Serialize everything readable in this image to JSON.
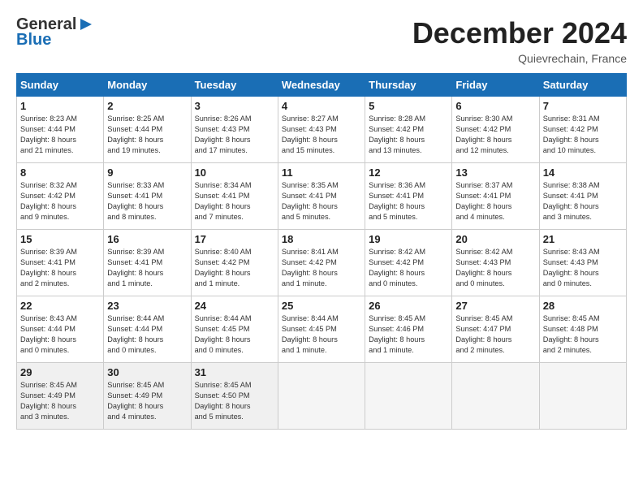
{
  "header": {
    "logo_line1": "General",
    "logo_line2": "Blue",
    "month_title": "December 2024",
    "location": "Quievrechain, France"
  },
  "days_of_week": [
    "Sunday",
    "Monday",
    "Tuesday",
    "Wednesday",
    "Thursday",
    "Friday",
    "Saturday"
  ],
  "weeks": [
    [
      {
        "day": "1",
        "text": "Sunrise: 8:23 AM\nSunset: 4:44 PM\nDaylight: 8 hours\nand 21 minutes."
      },
      {
        "day": "2",
        "text": "Sunrise: 8:25 AM\nSunset: 4:44 PM\nDaylight: 8 hours\nand 19 minutes."
      },
      {
        "day": "3",
        "text": "Sunrise: 8:26 AM\nSunset: 4:43 PM\nDaylight: 8 hours\nand 17 minutes."
      },
      {
        "day": "4",
        "text": "Sunrise: 8:27 AM\nSunset: 4:43 PM\nDaylight: 8 hours\nand 15 minutes."
      },
      {
        "day": "5",
        "text": "Sunrise: 8:28 AM\nSunset: 4:42 PM\nDaylight: 8 hours\nand 13 minutes."
      },
      {
        "day": "6",
        "text": "Sunrise: 8:30 AM\nSunset: 4:42 PM\nDaylight: 8 hours\nand 12 minutes."
      },
      {
        "day": "7",
        "text": "Sunrise: 8:31 AM\nSunset: 4:42 PM\nDaylight: 8 hours\nand 10 minutes."
      }
    ],
    [
      {
        "day": "8",
        "text": "Sunrise: 8:32 AM\nSunset: 4:42 PM\nDaylight: 8 hours\nand 9 minutes."
      },
      {
        "day": "9",
        "text": "Sunrise: 8:33 AM\nSunset: 4:41 PM\nDaylight: 8 hours\nand 8 minutes."
      },
      {
        "day": "10",
        "text": "Sunrise: 8:34 AM\nSunset: 4:41 PM\nDaylight: 8 hours\nand 7 minutes."
      },
      {
        "day": "11",
        "text": "Sunrise: 8:35 AM\nSunset: 4:41 PM\nDaylight: 8 hours\nand 5 minutes."
      },
      {
        "day": "12",
        "text": "Sunrise: 8:36 AM\nSunset: 4:41 PM\nDaylight: 8 hours\nand 5 minutes."
      },
      {
        "day": "13",
        "text": "Sunrise: 8:37 AM\nSunset: 4:41 PM\nDaylight: 8 hours\nand 4 minutes."
      },
      {
        "day": "14",
        "text": "Sunrise: 8:38 AM\nSunset: 4:41 PM\nDaylight: 8 hours\nand 3 minutes."
      }
    ],
    [
      {
        "day": "15",
        "text": "Sunrise: 8:39 AM\nSunset: 4:41 PM\nDaylight: 8 hours\nand 2 minutes."
      },
      {
        "day": "16",
        "text": "Sunrise: 8:39 AM\nSunset: 4:41 PM\nDaylight: 8 hours\nand 1 minute."
      },
      {
        "day": "17",
        "text": "Sunrise: 8:40 AM\nSunset: 4:42 PM\nDaylight: 8 hours\nand 1 minute."
      },
      {
        "day": "18",
        "text": "Sunrise: 8:41 AM\nSunset: 4:42 PM\nDaylight: 8 hours\nand 1 minute."
      },
      {
        "day": "19",
        "text": "Sunrise: 8:42 AM\nSunset: 4:42 PM\nDaylight: 8 hours\nand 0 minutes."
      },
      {
        "day": "20",
        "text": "Sunrise: 8:42 AM\nSunset: 4:43 PM\nDaylight: 8 hours\nand 0 minutes."
      },
      {
        "day": "21",
        "text": "Sunrise: 8:43 AM\nSunset: 4:43 PM\nDaylight: 8 hours\nand 0 minutes."
      }
    ],
    [
      {
        "day": "22",
        "text": "Sunrise: 8:43 AM\nSunset: 4:44 PM\nDaylight: 8 hours\nand 0 minutes."
      },
      {
        "day": "23",
        "text": "Sunrise: 8:44 AM\nSunset: 4:44 PM\nDaylight: 8 hours\nand 0 minutes."
      },
      {
        "day": "24",
        "text": "Sunrise: 8:44 AM\nSunset: 4:45 PM\nDaylight: 8 hours\nand 0 minutes."
      },
      {
        "day": "25",
        "text": "Sunrise: 8:44 AM\nSunset: 4:45 PM\nDaylight: 8 hours\nand 1 minute."
      },
      {
        "day": "26",
        "text": "Sunrise: 8:45 AM\nSunset: 4:46 PM\nDaylight: 8 hours\nand 1 minute."
      },
      {
        "day": "27",
        "text": "Sunrise: 8:45 AM\nSunset: 4:47 PM\nDaylight: 8 hours\nand 2 minutes."
      },
      {
        "day": "28",
        "text": "Sunrise: 8:45 AM\nSunset: 4:48 PM\nDaylight: 8 hours\nand 2 minutes."
      }
    ],
    [
      {
        "day": "29",
        "text": "Sunrise: 8:45 AM\nSunset: 4:49 PM\nDaylight: 8 hours\nand 3 minutes."
      },
      {
        "day": "30",
        "text": "Sunrise: 8:45 AM\nSunset: 4:49 PM\nDaylight: 8 hours\nand 4 minutes."
      },
      {
        "day": "31",
        "text": "Sunrise: 8:45 AM\nSunset: 4:50 PM\nDaylight: 8 hours\nand 5 minutes."
      },
      {
        "day": "",
        "text": ""
      },
      {
        "day": "",
        "text": ""
      },
      {
        "day": "",
        "text": ""
      },
      {
        "day": "",
        "text": ""
      }
    ]
  ]
}
